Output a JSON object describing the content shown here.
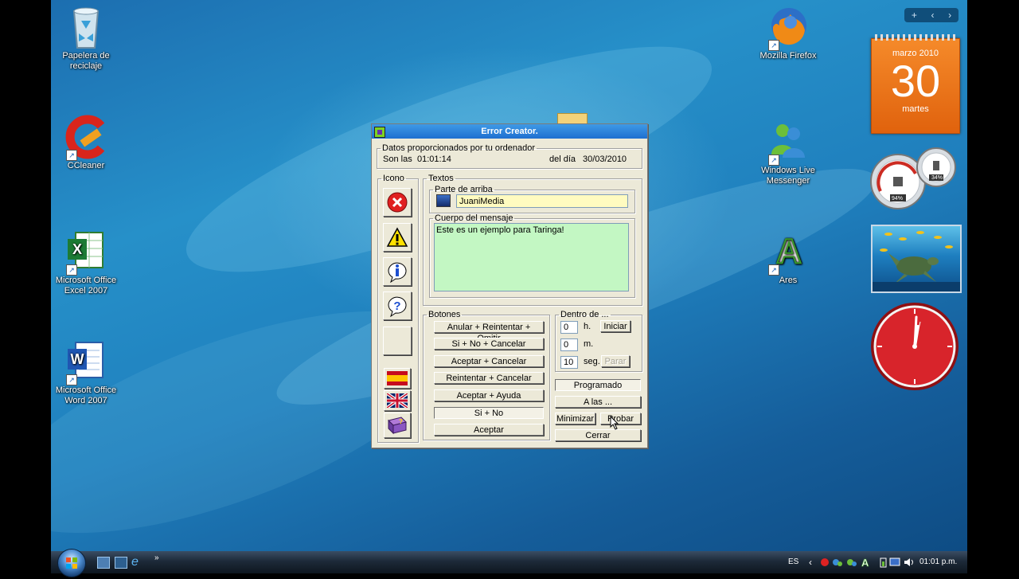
{
  "desktop_icons_left": [
    {
      "label": "Papelera de reciclaje",
      "icon": "recycle-bin-icon"
    },
    {
      "label": "CCleaner",
      "icon": "ccleaner-icon"
    },
    {
      "label": "Microsoft Office Excel 2007",
      "icon": "excel-icon"
    },
    {
      "label": "Microsoft Office Word 2007",
      "icon": "word-icon"
    }
  ],
  "desktop_icons_right": [
    {
      "label": "Mozilla Firefox",
      "icon": "firefox-icon"
    },
    {
      "label": "Windows Live Messenger",
      "icon": "messenger-icon"
    },
    {
      "label": "Ares",
      "icon": "ares-icon"
    }
  ],
  "gadgets": {
    "toolbar": {
      "add": "+",
      "prev": "‹",
      "next": "›"
    },
    "calendar": {
      "month_year": "marzo 2010",
      "day": "30",
      "weekday": "martes"
    },
    "meters": {
      "cpu": "94%",
      "ram": "34%"
    }
  },
  "dialog": {
    "title": "Error Creator.",
    "datos": {
      "legend": "Datos proporcionados por tu ordenador",
      "time_label": "Son las",
      "time": "01:01:14",
      "date_label": "del día",
      "date": "30/03/2010"
    },
    "icono": {
      "legend": "Icono"
    },
    "textos": {
      "legend": "Textos",
      "top_legend": "Parte de arriba",
      "top_value": "JuaniMedia",
      "body_legend": "Cuerpo del mensaje",
      "body_value": "Este es un ejemplo para Taringa!"
    },
    "botones": {
      "legend": "Botones",
      "options": [
        "Anular + Reintentar + Omitir",
        "Si + No + Cancelar",
        "Aceptar + Cancelar",
        "Reintentar + Cancelar",
        "Aceptar + Ayuda",
        "Si + No",
        "Aceptar"
      ],
      "selected_index": 5
    },
    "timer": {
      "legend": "Dentro de ...",
      "hours": "0",
      "hours_unit": "h.",
      "minutes": "0",
      "minutes_unit": "m.",
      "seconds": "10",
      "seconds_unit": "seg.",
      "start": "Iniciar",
      "stop": "Parar"
    },
    "actions": {
      "programado": "Programado",
      "a_las": "A las ...",
      "minimizar": "Minimizar",
      "probar": "Probar",
      "cerrar": "Cerrar"
    }
  },
  "taskbar": {
    "more": "»",
    "language": "ES",
    "clock": "01:01 p.m."
  }
}
